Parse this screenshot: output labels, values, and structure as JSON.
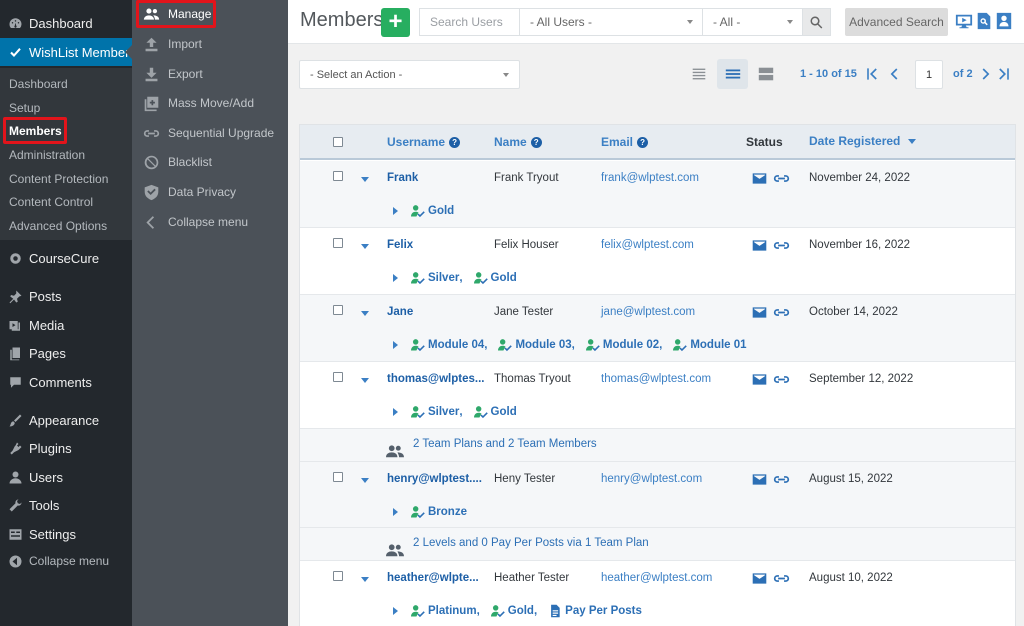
{
  "wp_menu": {
    "items": [
      {
        "label": "Dashboard",
        "icon": "dashboard-icon"
      },
      {
        "label": "WishList Member",
        "icon": "checkmark-icon"
      },
      {
        "label": "CourseCure",
        "icon": "course-icon"
      },
      {
        "label": "Posts",
        "icon": "pin-icon"
      },
      {
        "label": "Media",
        "icon": "media-icon"
      },
      {
        "label": "Pages",
        "icon": "pages-icon"
      },
      {
        "label": "Comments",
        "icon": "comment-icon"
      },
      {
        "label": "Appearance",
        "icon": "paintbrush-icon"
      },
      {
        "label": "Plugins",
        "icon": "plugin-icon"
      },
      {
        "label": "Users",
        "icon": "user-icon"
      },
      {
        "label": "Tools",
        "icon": "wrench-icon"
      },
      {
        "label": "Settings",
        "icon": "settings-icon"
      },
      {
        "label": "Collapse menu",
        "icon": "collapse-icon"
      }
    ],
    "submenu": [
      "Dashboard",
      "Setup",
      "Members",
      "Administration",
      "Content Protection",
      "Content Control",
      "Advanced Options"
    ]
  },
  "wl_menu": {
    "items": [
      {
        "label": "Manage",
        "icon": "users-icon"
      },
      {
        "label": "Import",
        "icon": "import-icon"
      },
      {
        "label": "Export",
        "icon": "export-icon"
      },
      {
        "label": "Mass Move/Add",
        "icon": "mass-move-icon"
      },
      {
        "label": "Sequential Upgrade",
        "icon": "link-icon"
      },
      {
        "label": "Blacklist",
        "icon": "blocked-icon"
      },
      {
        "label": "Data Privacy",
        "icon": "shield-icon"
      },
      {
        "label": "Collapse menu",
        "icon": "chevron-left-icon"
      }
    ]
  },
  "header": {
    "title": "Members",
    "add_label": "+",
    "search_placeholder": "Search Users",
    "users_filter": "- All Users -",
    "all_filter": "- All -",
    "advanced_search": "Advanced Search"
  },
  "toolbar": {
    "action_select": "- Select an Action -",
    "pager_range": "1 - 10",
    "pager_of": "of 15",
    "page": "1",
    "of_pages": "of 2"
  },
  "table": {
    "columns": {
      "username": "Username",
      "name": "Name",
      "email": "Email",
      "status": "Status",
      "date": "Date Registered"
    },
    "rows": [
      {
        "username": "Frank",
        "name": "Frank Tryout",
        "email": "frank@wlptest.com",
        "date": "November 24, 2022",
        "levels": [
          "Gold"
        ],
        "team": ""
      },
      {
        "username": "Felix",
        "name": "Felix Houser",
        "email": "felix@wlptest.com",
        "date": "November 16, 2022",
        "levels": [
          "Silver",
          "Gold"
        ],
        "team": ""
      },
      {
        "username": "Jane",
        "name": "Jane Tester",
        "email": "jane@wlptest.com",
        "date": "October 14, 2022",
        "levels": [
          "Module 04",
          "Module 03",
          "Module 02",
          "Module 01"
        ],
        "team": ""
      },
      {
        "username": "thomas@wlptes...",
        "name": "Thomas Tryout",
        "email": "thomas@wlptest.com",
        "date": "September 12, 2022",
        "levels": [
          "Silver",
          "Gold"
        ],
        "team": "2 Team Plans and 2 Team Members"
      },
      {
        "username": "henry@wlptest....",
        "name": "Heny Tester",
        "email": "henry@wlptest.com",
        "date": "August 15, 2022",
        "levels": [
          "Bronze"
        ],
        "team": "2 Levels and 0 Pay Per Posts via 1 Team Plan"
      },
      {
        "username": "heather@wlpte...",
        "name": "Heather Tester",
        "email": "heather@wlptest.com",
        "date": "August 10, 2022",
        "levels": [
          "Platinum",
          "Gold"
        ],
        "extra": "Pay Per Posts",
        "team": ""
      }
    ]
  }
}
